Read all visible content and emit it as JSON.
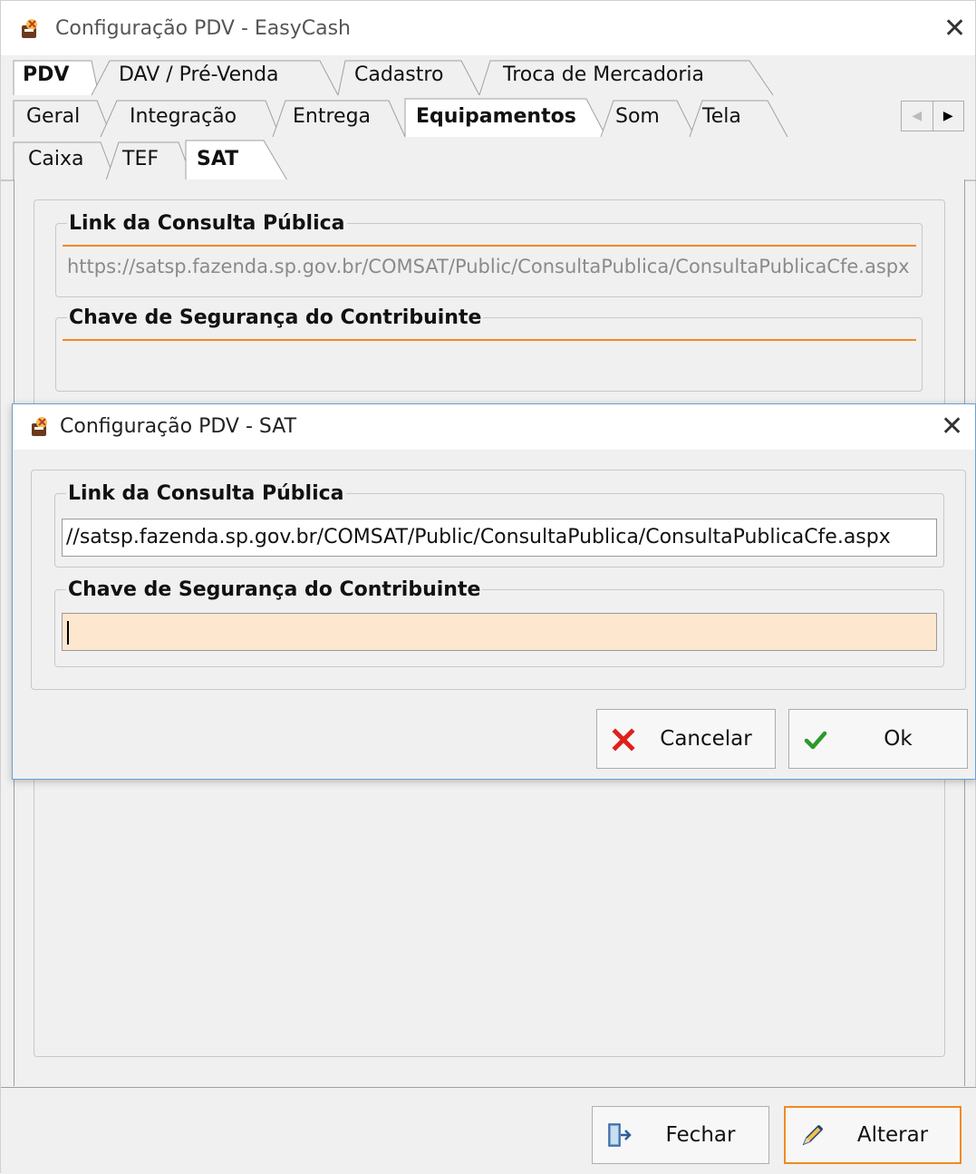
{
  "main_window": {
    "title": "Configuração PDV - EasyCash",
    "tabs_level1": [
      "PDV",
      "DAV / Pré-Venda",
      "Cadastro",
      "Troca de Mercadoria"
    ],
    "tabs_level2": [
      "Geral",
      "Integração",
      "Entrega",
      "Equipamentos",
      "Som",
      "Tela"
    ],
    "tabs_level3": [
      "Caixa",
      "TEF",
      "SAT"
    ],
    "active_tabs": [
      "PDV",
      "Equipamentos",
      "SAT"
    ],
    "link_group_label": "Link da Consulta Pública",
    "link_value": "https://satsp.fazenda.sp.gov.br/COMSAT/Public/ConsultaPublica/ConsultaPublicaCfe.aspx",
    "key_group_label": "Chave de Segurança do Contribuinte",
    "key_value": "",
    "buttons": {
      "close": "Fechar",
      "edit": "Alterar"
    }
  },
  "dialog": {
    "title": "Configuração PDV - SAT",
    "link_group_label": "Link da Consulta Pública",
    "link_value": "//satsp.fazenda.sp.gov.br/COMSAT/Public/ConsultaPublica/ConsultaPublicaCfe.aspx",
    "key_group_label": "Chave de Segurança do Contribuinte",
    "key_value": "",
    "buttons": {
      "cancel": "Cancelar",
      "ok": "Ok"
    }
  },
  "colors": {
    "accent_orange": "#f08a24",
    "input_active_bg": "#fde7cf",
    "cancel_icon": "#e0201a",
    "ok_icon": "#2a9a2a"
  },
  "icons": [
    "app-icon",
    "close-icon",
    "scroll-left-icon",
    "scroll-right-icon",
    "cancel-x-icon",
    "ok-check-icon",
    "exit-door-icon",
    "pencil-icon"
  ]
}
